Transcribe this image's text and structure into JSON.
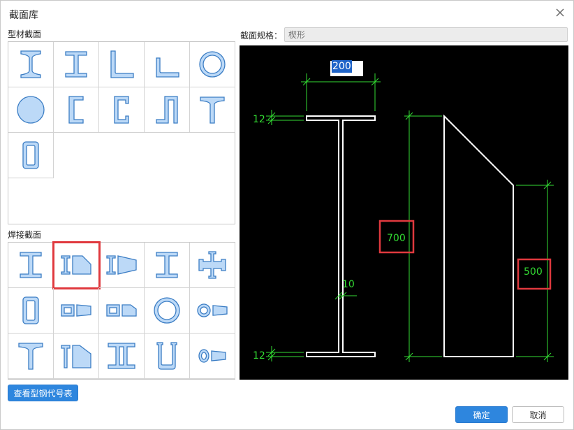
{
  "dialog": {
    "title": "截面库",
    "close_icon": "close-icon"
  },
  "profile_section": {
    "label": "型材截面",
    "items": [
      {
        "name": "i-beam-icon"
      },
      {
        "name": "h-beam-icon"
      },
      {
        "name": "equal-angle-icon"
      },
      {
        "name": "unequal-angle-icon"
      },
      {
        "name": "round-tube-icon"
      },
      {
        "name": "solid-round-icon"
      },
      {
        "name": "channel-icon"
      },
      {
        "name": "lipped-channel-icon"
      },
      {
        "name": "z-section-icon"
      },
      {
        "name": "t-section-icon"
      },
      {
        "name": "rect-tube-icon"
      }
    ]
  },
  "welded_section": {
    "label": "焊接截面",
    "items": [
      {
        "name": "welded-i-beam-icon"
      },
      {
        "name": "welded-tapered-i-icon",
        "selected": true
      },
      {
        "name": "welded-tapered-side-icon"
      },
      {
        "name": "welded-h-beam-icon"
      },
      {
        "name": "welded-cross-icon"
      },
      {
        "name": "welded-box-icon"
      },
      {
        "name": "welded-tapered-box-icon"
      },
      {
        "name": "welded-tapered-box2-icon"
      },
      {
        "name": "welded-round-tube-icon"
      },
      {
        "name": "welded-tapered-tube-icon"
      },
      {
        "name": "welded-t-icon"
      },
      {
        "name": "welded-tapered-t-icon"
      },
      {
        "name": "welded-double-i-icon"
      },
      {
        "name": "welded-u-icon"
      },
      {
        "name": "welded-tapered-ellipse-icon"
      }
    ]
  },
  "spec": {
    "label": "截面规格：",
    "placeholder": "楔形"
  },
  "drawing": {
    "flange_width": "200",
    "flange_thickness_top": "12",
    "flange_thickness_bottom": "12",
    "web_thickness": "10",
    "height_start": "700",
    "height_end": "500",
    "colors": {
      "dimension": "#33dd33",
      "outline": "#ffffff",
      "highlight": "#e0393e",
      "background": "#000000"
    }
  },
  "buttons": {
    "view_table": "查看型钢代号表",
    "ok": "确定",
    "cancel": "取消"
  }
}
